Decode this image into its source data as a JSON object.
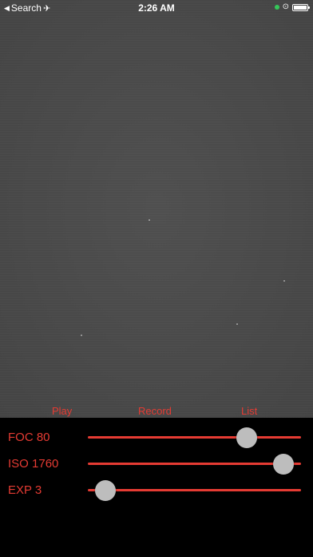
{
  "status_bar": {
    "back_label": "Search",
    "time": "2:26 AM",
    "back_icon": "triangle-left-icon",
    "airplane_icon": "airplane-icon",
    "lock_icon": "rotation-lock-icon",
    "battery_icon": "battery-icon"
  },
  "actions": {
    "play": "Play",
    "record": "Record",
    "list": "List"
  },
  "controls": [
    {
      "label": "FOC 80",
      "level": 0.77
    },
    {
      "label": "ISO 1760",
      "level": 0.96
    },
    {
      "label": "EXP 3",
      "level": 0.04
    }
  ],
  "colors": {
    "accent": "#e53b33",
    "thumb": "#bdbdbd",
    "panel": "#000000",
    "viewfinder": "#4b4b4b"
  }
}
